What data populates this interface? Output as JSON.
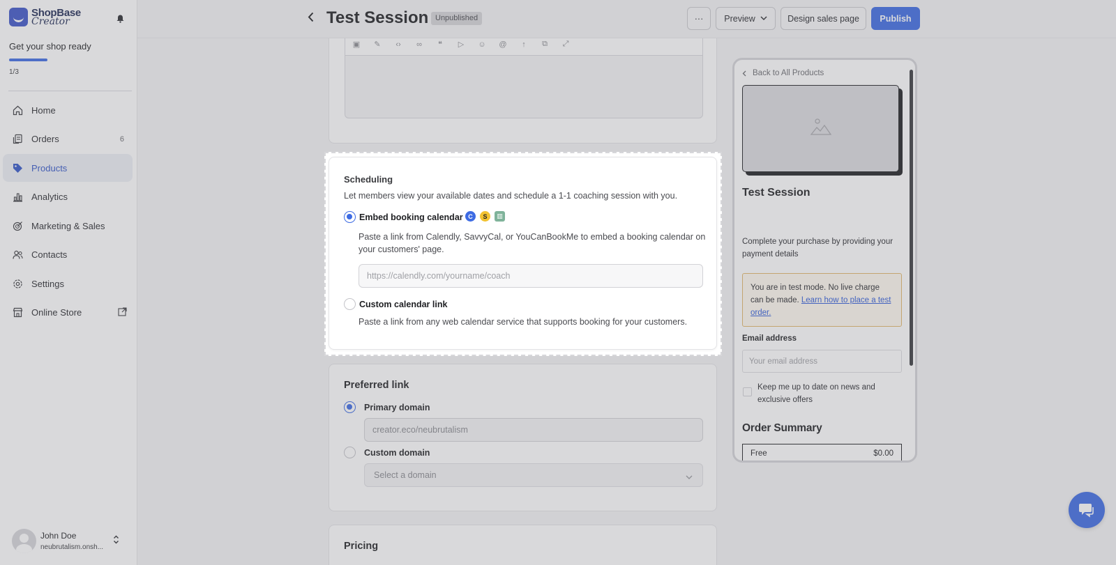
{
  "brand": {
    "line1": "ShopBase",
    "line2": "Creator"
  },
  "onboarding": {
    "title": "Get your shop ready",
    "progress": 0.33,
    "count": "1/3"
  },
  "nav": [
    {
      "label": "Home",
      "icon": "home-icon"
    },
    {
      "label": "Orders",
      "icon": "orders-icon",
      "badge": "6"
    },
    {
      "label": "Products",
      "icon": "tag-icon",
      "active": true
    },
    {
      "label": "Analytics",
      "icon": "analytics-icon"
    },
    {
      "label": "Marketing & Sales",
      "icon": "marketing-icon"
    },
    {
      "label": "Contacts",
      "icon": "contacts-icon"
    },
    {
      "label": "Settings",
      "icon": "gear-icon"
    },
    {
      "label": "Online Store",
      "icon": "store-icon",
      "external": true
    }
  ],
  "user": {
    "name": "John Doe",
    "store": "neubrutalism.onsh..."
  },
  "header": {
    "title": "Test Session",
    "status": "Unpublished",
    "more": "···",
    "preview": "Preview",
    "design": "Design sales page",
    "publish": "Publish"
  },
  "scheduling": {
    "title": "Scheduling",
    "description": "Let members view your available dates and schedule a 1-1 coaching session with you.",
    "embed_label": "Embed booking calendar",
    "embed_desc_1": "Paste a link from Calendly, SavvyCal, or YouCanBookMe to embed a booking calendar on",
    "embed_desc_2": "your customers' page.",
    "embed_placeholder": "https://calendly.com/yourname/coach",
    "custom_label": "Custom calendar link",
    "custom_desc": "Paste a link from any web calendar service that supports booking for your customers.",
    "selected": "embed"
  },
  "preferred_link": {
    "title": "Preferred link",
    "primary_label": "Primary domain",
    "primary_value": "creator.eco/neubrutalism",
    "custom_label": "Custom domain",
    "custom_placeholder": "Select a domain",
    "selected": "primary"
  },
  "pricing": {
    "title": "Pricing"
  },
  "preview_panel": {
    "back": "Back to All Products",
    "product_title": "Test Session",
    "checkout_desc": "Complete your purchase by providing your payment details",
    "test_text": "You are in test mode. No live charge can be made.",
    "test_link": "Learn how to place a test order.",
    "email_label": "Email address",
    "email_placeholder": "Your email address",
    "newsletter": "Keep me up to date on news and exclusive offers",
    "summary_title": "Order Summary",
    "summary_item": "Free",
    "summary_price": "$0.00"
  },
  "colors": {
    "accent": "#3d6be3",
    "warning_border": "#e2b86b",
    "sidebar_active_bg": "#eef0f5"
  }
}
